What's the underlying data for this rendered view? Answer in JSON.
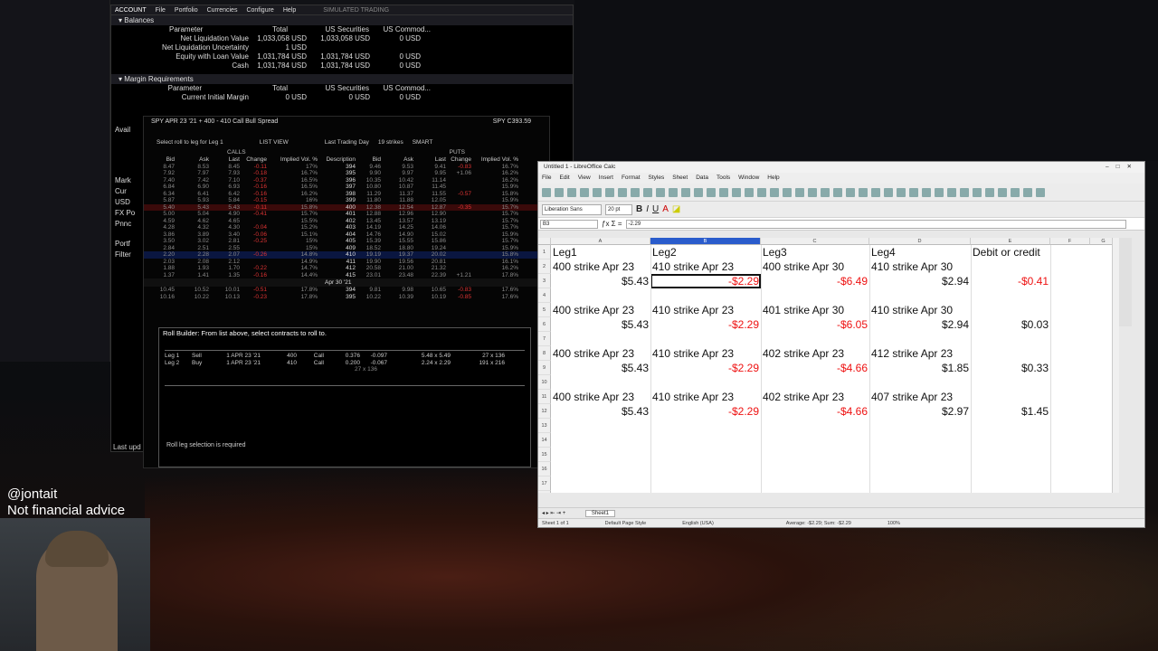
{
  "overlay": {
    "handle": "@jontait",
    "disclaimer": "Not financial advice"
  },
  "account_window": {
    "title": "ACCOUNT",
    "menu": [
      "File",
      "Portfolio",
      "Currencies",
      "Configure",
      "Help"
    ],
    "simulated": "SIMULATED TRADING",
    "balances_header": "Balances",
    "headers": [
      "Parameter",
      "Total",
      "US Securities",
      "US Commod..."
    ],
    "rows": [
      {
        "param": "Net Liquidation Value",
        "total": "1,033,058 USD",
        "sec": "1,033,058 USD",
        "com": "0 USD"
      },
      {
        "param": "Net Liquidation Uncertainty",
        "total": "1 USD",
        "sec": "",
        "com": ""
      },
      {
        "param": "Equity with Loan Value",
        "total": "1,031,784 USD",
        "sec": "1,031,784 USD",
        "com": "0 USD"
      },
      {
        "param": "Cash",
        "total": "1,031,784 USD",
        "sec": "1,031,784 USD",
        "com": "0 USD"
      }
    ],
    "margin_header": "Margin Requirements",
    "margin_rows": [
      {
        "param": "Current Initial Margin",
        "total": "0 USD",
        "sec": "0 USD",
        "com": "0 USD"
      }
    ],
    "side_labels": [
      "Avail",
      "Mark",
      "Cur",
      "USD",
      "FX Po",
      "Pnnc",
      "Portf",
      "Filter"
    ],
    "last_update": "Last upd"
  },
  "spread_window": {
    "title": "SPY APR 23 '21 + 400 - 410 Call Bull Spread",
    "price": "SPY  C393.59",
    "select_label": "Select roll to leg for  Leg 1",
    "list_view": "LIST VIEW",
    "last_trading_day": "Last Trading Day",
    "strikes": "19 strikes",
    "smart": "SMART",
    "calls": "CALLS",
    "puts": "PUTS",
    "col_headers": [
      "Bid",
      "Ask",
      "Last",
      "Change",
      "Implied Vol. %",
      "Description",
      "Bid",
      "Ask",
      "Last",
      "Change",
      "Implied Vol. %"
    ],
    "rows": [
      {
        "bid": "8.47",
        "ask": "8.53",
        "last": "8.45",
        "chg": "-0.11",
        "iv": "17%",
        "desc": "394",
        "pbid": "9.46",
        "pask": "9.53",
        "plast": "9.41",
        "pchg": "-0.83",
        "piv": "16.7%"
      },
      {
        "bid": "7.92",
        "ask": "7.97",
        "last": "7.93",
        "chg": "-0.18",
        "iv": "16.7%",
        "desc": "395",
        "pbid": "9.90",
        "pask": "9.97",
        "plast": "9.95",
        "pchg": "+1.06",
        "piv": "16.2%"
      },
      {
        "bid": "7.40",
        "ask": "7.42",
        "last": "7.10",
        "chg": "-0.37",
        "iv": "16.5%",
        "desc": "396",
        "pbid": "10.35",
        "pask": "10.42",
        "plast": "11.14",
        "pchg": "",
        "piv": "16.2%"
      },
      {
        "bid": "6.84",
        "ask": "6.90",
        "last": "6.93",
        "chg": "-0.16",
        "iv": "16.5%",
        "desc": "397",
        "pbid": "10.80",
        "pask": "10.87",
        "plast": "11.45",
        "pchg": "",
        "piv": "15.9%"
      },
      {
        "bid": "6.34",
        "ask": "6.41",
        "last": "6.42",
        "chg": "-0.16",
        "iv": "16.2%",
        "desc": "398",
        "pbid": "11.29",
        "pask": "11.37",
        "plast": "11.55",
        "pchg": "-0.57",
        "piv": "15.8%"
      },
      {
        "bid": "5.87",
        "ask": "5.93",
        "last": "5.84",
        "chg": "-0.15",
        "iv": "16%",
        "desc": "399",
        "pbid": "11.80",
        "pask": "11.88",
        "plast": "12.05",
        "pchg": "",
        "piv": "15.9%"
      },
      {
        "bid": "5.40",
        "ask": "5.43",
        "last": "5.43",
        "chg": "-0.11",
        "iv": "15.8%",
        "desc": "400",
        "pbid": "12.38",
        "pask": "12.54",
        "plast": "12.87",
        "pchg": "-0.35",
        "piv": "15.7%"
      },
      {
        "bid": "5.00",
        "ask": "5.04",
        "last": "4.90",
        "chg": "-0.41",
        "iv": "15.7%",
        "desc": "401",
        "pbid": "12.88",
        "pask": "12.96",
        "plast": "12.90",
        "pchg": "",
        "piv": "15.7%"
      },
      {
        "bid": "4.59",
        "ask": "4.62",
        "last": "4.65",
        "chg": "",
        "iv": "15.5%",
        "desc": "402",
        "pbid": "13.45",
        "pask": "13.57",
        "plast": "13.19",
        "pchg": "",
        "piv": "15.7%"
      },
      {
        "bid": "4.28",
        "ask": "4.32",
        "last": "4.30",
        "chg": "-0.04",
        "iv": "15.2%",
        "desc": "403",
        "pbid": "14.19",
        "pask": "14.25",
        "plast": "14.06",
        "pchg": "",
        "piv": "15.7%"
      },
      {
        "bid": "3.86",
        "ask": "3.89",
        "last": "3.40",
        "chg": "-0.06",
        "iv": "15.1%",
        "desc": "404",
        "pbid": "14.76",
        "pask": "14.90",
        "plast": "15.02",
        "pchg": "",
        "piv": "15.9%"
      },
      {
        "bid": "3.50",
        "ask": "3.02",
        "last": "2.81",
        "chg": "-0.25",
        "iv": "15%",
        "desc": "405",
        "pbid": "15.39",
        "pask": "15.55",
        "plast": "15.86",
        "pchg": "",
        "piv": "15.7%"
      },
      {
        "bid": "2.84",
        "ask": "2.51",
        "last": "2.55",
        "chg": "",
        "iv": "15%",
        "desc": "409",
        "pbid": "18.52",
        "pask": "18.80",
        "plast": "19.24",
        "pchg": "",
        "piv": "15.9%"
      },
      {
        "bid": "2.20",
        "ask": "2.28",
        "last": "2.07",
        "chg": "-0.26",
        "iv": "14.8%",
        "desc": "410",
        "pbid": "19.19",
        "pask": "19.37",
        "plast": "20.02",
        "pchg": "",
        "piv": "15.8%"
      },
      {
        "bid": "2.03",
        "ask": "2.08",
        "last": "2.12",
        "chg": "",
        "iv": "14.9%",
        "desc": "411",
        "pbid": "19.90",
        "pask": "19.56",
        "plast": "20.81",
        "pchg": "",
        "piv": "16.1%"
      },
      {
        "bid": "1.88",
        "ask": "1.93",
        "last": "1.70",
        "chg": "-0.22",
        "iv": "14.7%",
        "desc": "412",
        "pbid": "20.58",
        "pask": "21.00",
        "plast": "21.32",
        "pchg": "",
        "piv": "16.2%"
      },
      {
        "bid": "1.37",
        "ask": "1.41",
        "last": "1.35",
        "chg": "-0.16",
        "iv": "14.4%",
        "desc": "415",
        "pbid": "23.01",
        "pask": "23.48",
        "plast": "22.39",
        "pchg": "+1.21",
        "piv": "17.8%"
      }
    ],
    "expiry_bar": "Apr 30 '21",
    "lower_rows": [
      {
        "bid": "10.45",
        "ask": "10.52",
        "last": "10.01",
        "chg": "-0.51",
        "iv": "17.8%",
        "desc": "394",
        "pbid": "9.81",
        "pask": "9.98",
        "plast": "10.65",
        "pchg": "-0.83",
        "piv": "17.6%"
      },
      {
        "bid": "10.16",
        "ask": "10.22",
        "last": "10.13",
        "chg": "-0.23",
        "iv": "17.8%",
        "desc": "395",
        "pbid": "10.22",
        "pask": "10.39",
        "plast": "10.19",
        "pchg": "-0.85",
        "piv": "17.6%"
      }
    ]
  },
  "roll_builder": {
    "title": "Roll Builder: From list above, select contracts to roll to.",
    "legs": [
      {
        "label": "Leg 1",
        "action": "Sell",
        "expiry": "1 APR 23 '21",
        "strike": "400",
        "right": "Call",
        "delta": "0.376",
        "theta": "-0.097",
        "bidask": "5.48 x 5.49",
        "size": "27 x 136"
      },
      {
        "label": "Leg 2",
        "action": "Buy",
        "expiry": "1 APR 23 '21",
        "strike": "410",
        "right": "Call",
        "delta": "0.200",
        "theta": "-0.067",
        "bidask": "2.24 x 2.29",
        "size": "191 x 216"
      }
    ],
    "sum": "27 x 136",
    "status": "Roll leg selection is required"
  },
  "calc": {
    "title": "Untitled 1 - LibreOffice Calc",
    "menu": [
      "File",
      "Edit",
      "View",
      "Insert",
      "Format",
      "Styles",
      "Sheet",
      "Data",
      "Tools",
      "Window",
      "Help"
    ],
    "font_name": "Liberation Sans",
    "font_size": "20 pt",
    "cell_ref": "B3",
    "formula": "-2.29",
    "columns": [
      "A",
      "B",
      "C",
      "D",
      "E",
      "F",
      "G"
    ],
    "rows": [
      {
        "n": "1",
        "a": "Leg1",
        "b": "Leg2",
        "c": "Leg3",
        "d": "Leg4",
        "e": "Debit or credit"
      },
      {
        "n": "2",
        "a": "400 strike Apr 23",
        "b": "410 strike Apr 23",
        "c": "400 strike Apr 30",
        "d": "410 strike Apr 30",
        "e": ""
      },
      {
        "n": "3",
        "a": "$5.43",
        "b": "-$2.29",
        "c": "-$6.49",
        "d": "$2.94",
        "e": "-$0.41"
      },
      {
        "n": "4",
        "a": "",
        "b": "",
        "c": "",
        "d": "",
        "e": ""
      },
      {
        "n": "5",
        "a": "400 strike Apr 23",
        "b": "410 strike Apr 23",
        "c": "401 strike Apr 30",
        "d": "410 strike Apr 30",
        "e": ""
      },
      {
        "n": "6",
        "a": "$5.43",
        "b": "-$2.29",
        "c": "-$6.05",
        "d": "$2.94",
        "e": "$0.03"
      },
      {
        "n": "7",
        "a": "",
        "b": "",
        "c": "",
        "d": "",
        "e": ""
      },
      {
        "n": "8",
        "a": "400 strike Apr 23",
        "b": "410 strike Apr 23",
        "c": "402 strike Apr 23",
        "d": "412 strike Apr 23",
        "e": ""
      },
      {
        "n": "9",
        "a": "$5.43",
        "b": "-$2.29",
        "c": "-$4.66",
        "d": "$1.85",
        "e": "$0.33"
      },
      {
        "n": "10",
        "a": "",
        "b": "",
        "c": "",
        "d": "",
        "e": ""
      },
      {
        "n": "11",
        "a": "400 strike Apr 23",
        "b": "410 strike Apr 23",
        "c": "402 strike Apr 23",
        "d": "407 strike Apr 23",
        "e": ""
      },
      {
        "n": "12",
        "a": "$5.43",
        "b": "-$2.29",
        "c": "-$4.66",
        "d": "$2.97",
        "e": "$1.45"
      },
      {
        "n": "13"
      },
      {
        "n": "14"
      },
      {
        "n": "15"
      },
      {
        "n": "16"
      },
      {
        "n": "17"
      },
      {
        "n": "18"
      }
    ],
    "sheet_tab": "Sheet1",
    "status": {
      "sheet": "Sheet 1 of 1",
      "style": "Default Page Style",
      "lang": "English (USA)",
      "sum": "Average: -$2.29; Sum: -$2.29",
      "zoom": "100%"
    }
  },
  "colors": {
    "negative": "#e11111",
    "accent_blue": "#2266ee",
    "ib_red": "#cc2222"
  }
}
